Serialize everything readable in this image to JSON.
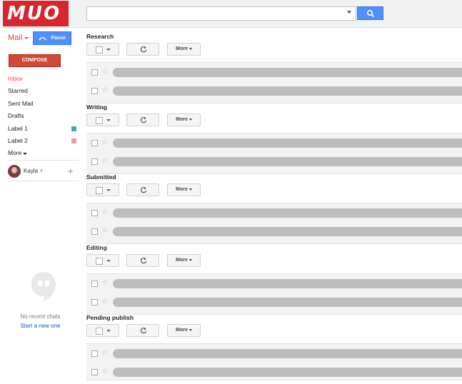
{
  "header": {
    "logo": "MUO",
    "search": {
      "placeholder": ""
    }
  },
  "sidebar": {
    "mail_label": "Mail",
    "pause_label": "Pause",
    "compose_label": "COMPOSE",
    "nav": [
      {
        "label": "Inbox",
        "active": true
      },
      {
        "label": "Starred"
      },
      {
        "label": "Sent Mail"
      },
      {
        "label": "Drafts"
      },
      {
        "label": "Label 1",
        "color": "#3fa9b5"
      },
      {
        "label": "Label 2",
        "color": "#e89aa8"
      },
      {
        "label": "More"
      }
    ],
    "user": {
      "name": "Kayla"
    },
    "chat": {
      "empty_text": "No recent chats",
      "start_link": "Start a new one"
    }
  },
  "toolbar": {
    "more_label": "More"
  },
  "sections": [
    {
      "title": "Research"
    },
    {
      "title": "Writing"
    },
    {
      "title": "Submitted"
    },
    {
      "title": "Editing"
    },
    {
      "title": "Pending publish"
    }
  ],
  "colors": {
    "accent": "#dd4b39",
    "primary_button": "#4d90fe",
    "compose": "#d14836",
    "logo_bg": "#d8262e"
  }
}
